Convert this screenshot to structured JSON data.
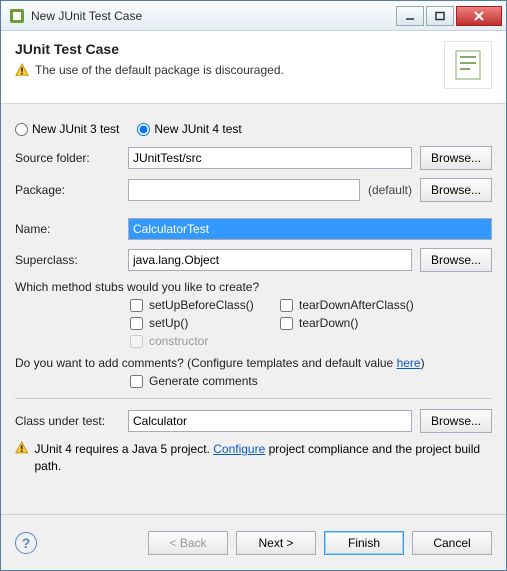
{
  "window": {
    "title": "New JUnit Test Case"
  },
  "banner": {
    "title": "JUnit Test Case",
    "warning": "The use of the default package is discouraged."
  },
  "radios": {
    "junit3": "New JUnit 3 test",
    "junit4": "New JUnit 4 test"
  },
  "labels": {
    "source": "Source folder:",
    "package": "Package:",
    "name": "Name:",
    "superclass": "Superclass:",
    "classUnderTest": "Class under test:"
  },
  "fields": {
    "source": "JUnitTest/src",
    "package": "",
    "name": "CalculatorTest",
    "superclass": "java.lang.Object",
    "classUnderTest": "Calculator"
  },
  "defaultTag": "(default)",
  "browse": "Browse...",
  "stubsQuestion": "Which method stubs would you like to create?",
  "stubs": {
    "setUpBeforeClass": "setUpBeforeClass()",
    "tearDownAfterClass": "tearDownAfterClass()",
    "setUp": "setUp()",
    "tearDown": "tearDown()",
    "constructor": "constructor"
  },
  "comments": {
    "question_pre": "Do you want to add comments? (Configure templates and default value ",
    "link": "here",
    "question_post": ")",
    "generate": "Generate comments"
  },
  "bottomWarning": {
    "pre": "JUnit 4 requires a Java 5 project. ",
    "link": "Configure",
    "post": " project compliance and the project build path."
  },
  "footer": {
    "back": "< Back",
    "next": "Next >",
    "finish": "Finish",
    "cancel": "Cancel"
  }
}
